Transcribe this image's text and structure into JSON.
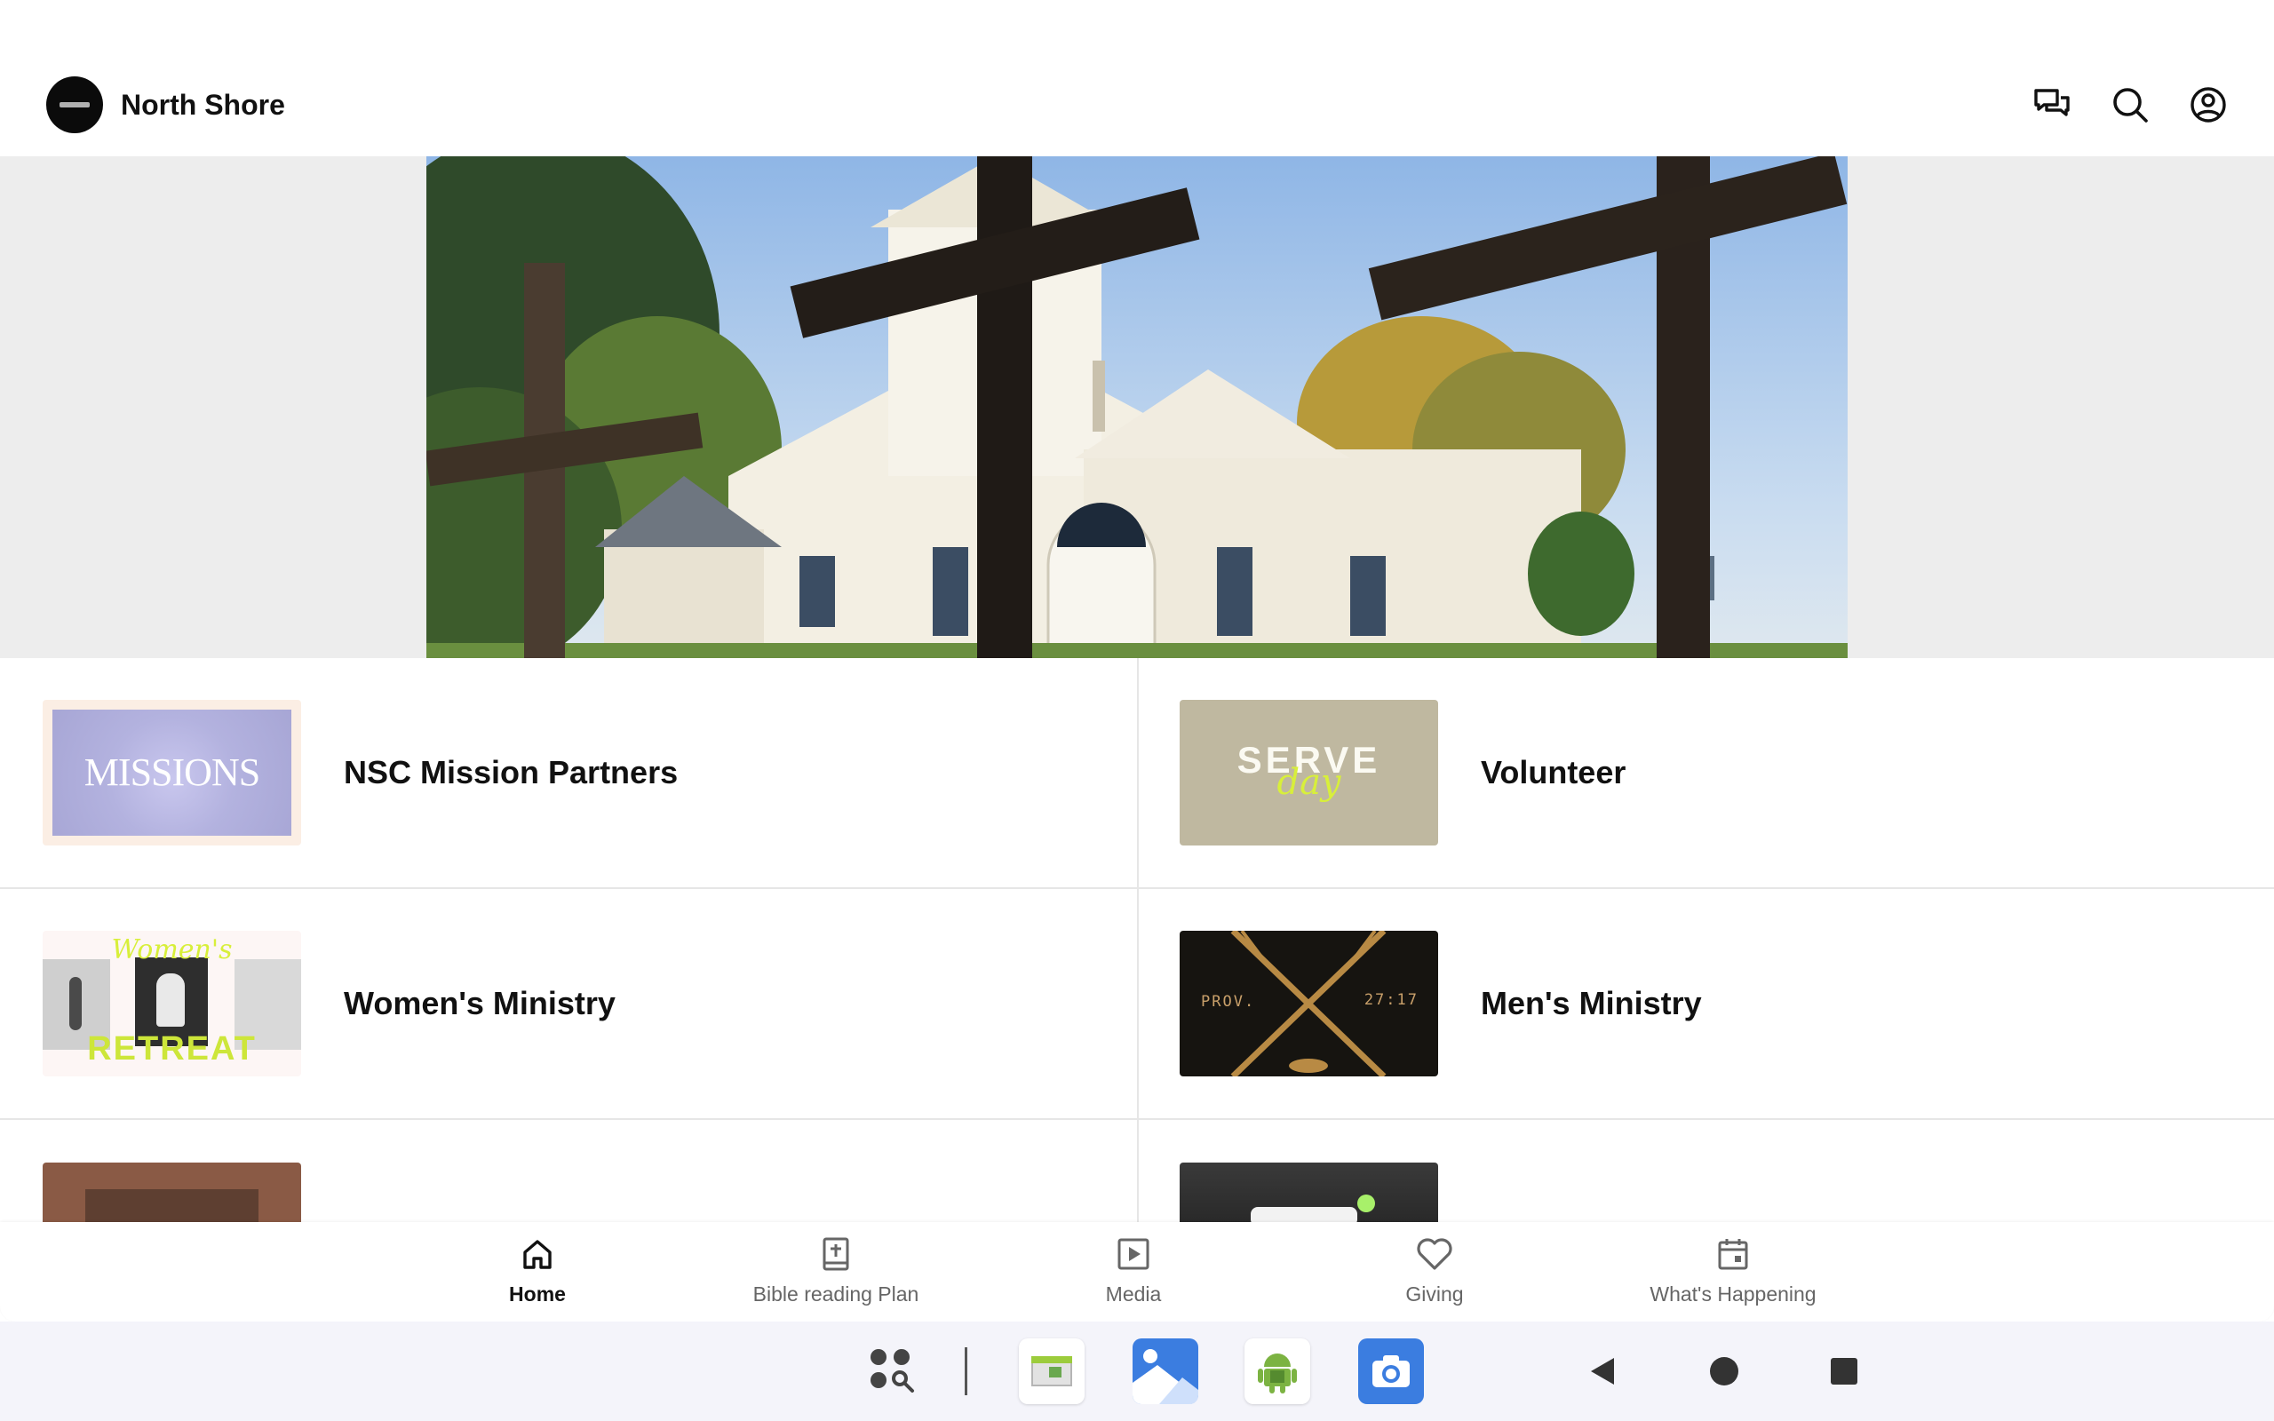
{
  "header": {
    "app_title": "North Shore",
    "icons": [
      "chat-icon",
      "search-icon",
      "account-icon"
    ]
  },
  "hero": {
    "alt": "Church with three wooden crosses"
  },
  "list": {
    "rows": [
      [
        {
          "label": "NSC Mission Partners",
          "thumb_text": "MISSIONS"
        },
        {
          "label": "Volunteer",
          "thumb_text": "SERVE",
          "thumb_script": "day"
        }
      ],
      [
        {
          "label": "Women's Ministry",
          "thumb_text": "RETREAT",
          "thumb_script": "Women's"
        },
        {
          "label": "Men's Ministry",
          "thumb_text_left": "PROV.",
          "thumb_text_right": "27:17"
        }
      ],
      [
        {
          "label": ""
        },
        {
          "label": ""
        }
      ]
    ]
  },
  "bottom_nav": {
    "items": [
      {
        "label": "Home",
        "icon": "home-icon",
        "active": true
      },
      {
        "label": "Bible reading Plan",
        "icon": "bible-icon",
        "active": false
      },
      {
        "label": "Media",
        "icon": "play-icon",
        "active": false
      },
      {
        "label": "Giving",
        "icon": "heart-icon",
        "active": false
      },
      {
        "label": "What's Happening",
        "icon": "calendar-icon",
        "active": false
      }
    ]
  },
  "system_bar": {
    "apps": [
      "app-drawer-icon",
      "spreadsheet-app-icon",
      "gallery-app-icon",
      "android-app-icon",
      "camera-app-icon"
    ],
    "nav": [
      "back-icon",
      "home-circle-icon",
      "recents-icon"
    ]
  },
  "colors": {
    "accent": "#111111",
    "nav_inactive": "#666666",
    "divider": "#e6e6e6",
    "hero_bg": "#ededed"
  }
}
